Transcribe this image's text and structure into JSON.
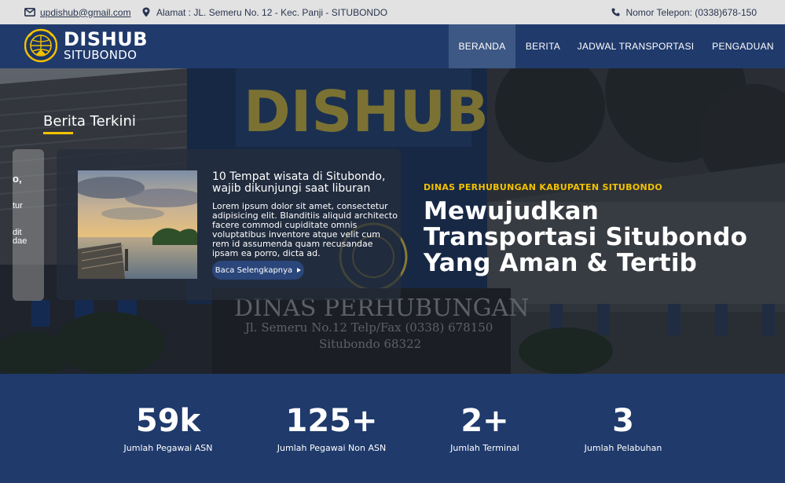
{
  "topbar": {
    "email": "updishub@gmail.com",
    "address": "Alamat : JL. Semeru No. 12 - Kec. Panji - SITUBONDO",
    "phone": "Nomor Telepon: (0338)678-150"
  },
  "logo": {
    "title": "DISHUB",
    "subtitle": "SITUBONDO"
  },
  "nav": {
    "items": [
      {
        "label": "BERANDA",
        "active": true
      },
      {
        "label": "BERITA"
      },
      {
        "label": "JADWAL TRANSPORTASI"
      },
      {
        "label": "PENGADUAN"
      }
    ]
  },
  "hero": {
    "sign_text_top": "DISHUB",
    "sign_text_bottom": "DINAS PERHUBUNGAN",
    "sign_address": "Jl. Semeru No.12 Telp/Fax (0338) 678150",
    "sign_city": "Situbondo 68322",
    "section_title": "Berita Terkini",
    "left_card_fragments": [
      "o,",
      "tur",
      "dit",
      "dae"
    ],
    "card": {
      "title": "10 Tempat wisata di Situbondo, wajib dikunjungi saat liburan",
      "body": "Lorem ipsum dolor sit amet, consectetur adipisicing elit. Blanditiis aliquid architecto facere commodi cupiditate omnis voluptatibus inventore atque velit cum rem id assumenda quam recusandae ipsam ea porro, dicta ad.",
      "button": "Baca Selengkapnya"
    },
    "kicker": "DINAS PERHUBUNGAN KABUPATEN SITUBONDO",
    "heading": "Mewujudkan Transportasi Situbondo Yang Aman & Tertib"
  },
  "stats": [
    {
      "value": "59k",
      "label": "Jumlah Pegawai ASN"
    },
    {
      "value": "125+",
      "label": "Jumlah Pegawai Non ASN"
    },
    {
      "value": "2+",
      "label": "Jumlah Terminal"
    },
    {
      "value": "3",
      "label": "Jumlah Pelabuhan"
    }
  ],
  "colors": {
    "brand_blue": "#203a6c",
    "accent_yellow": "#f2c200",
    "topbar_gray": "#e2e2e2",
    "active_nav": "#3d5884"
  }
}
